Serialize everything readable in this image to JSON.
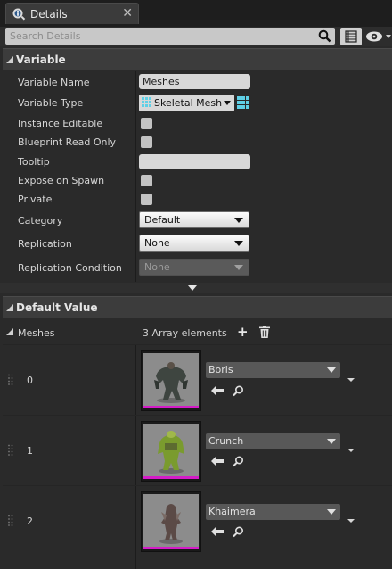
{
  "tab": {
    "title": "Details",
    "close": "✕"
  },
  "search": {
    "placeholder": "Search Details"
  },
  "sections": {
    "variable": "Variable",
    "default_value": "Default Value"
  },
  "variable_rows": {
    "name_label": "Variable Name",
    "name_value": "Meshes",
    "type_label": "Variable Type",
    "type_value": "Skeletal Mesh",
    "instance_editable": "Instance Editable",
    "blueprint_read_only": "Blueprint Read Only",
    "tooltip": "Tooltip",
    "tooltip_value": "",
    "expose_on_spawn": "Expose on Spawn",
    "private": "Private",
    "category_label": "Category",
    "category_value": "Default",
    "replication_label": "Replication",
    "replication_value": "None",
    "replication_condition_label": "Replication Condition",
    "replication_condition_value": "None"
  },
  "default_value": {
    "array_label": "Meshes",
    "array_count": "3 Array elements",
    "elements": [
      {
        "index": "0",
        "asset": "Boris"
      },
      {
        "index": "1",
        "asset": "Crunch"
      },
      {
        "index": "2",
        "asset": "Khaimera"
      }
    ]
  },
  "colors": {
    "accent_pink": "#d41cc8",
    "type_cyan": "#5fd0e6"
  },
  "icons": [
    "details-tab-icon",
    "search-icon",
    "grid-view-icon",
    "eye-icon",
    "pin-grid-icon",
    "add-icon",
    "trash-icon",
    "use-selected-icon",
    "browse-icon"
  ]
}
